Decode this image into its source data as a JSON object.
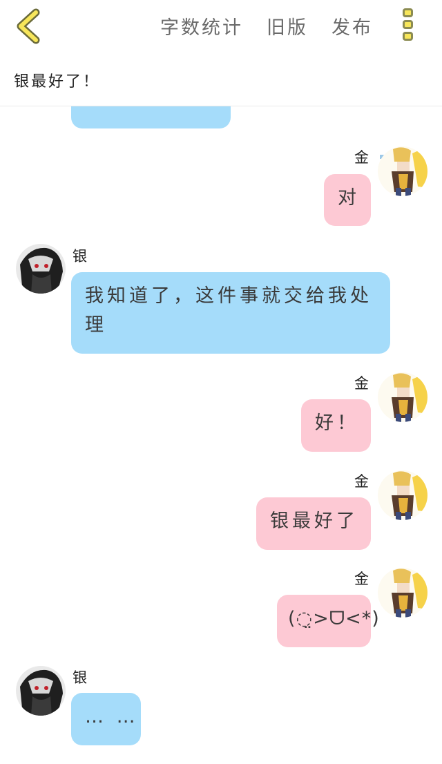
{
  "header": {
    "back_icon": "chevron-left-icon",
    "actions": [
      "字数统计",
      "旧版",
      "发布"
    ],
    "menu_icon": "more-vertical-icon",
    "accent": "#f7e65a"
  },
  "subtitle": "银最好了！",
  "characters": {
    "gin": {
      "name": "银",
      "bubble_color": "#a5dcfa"
    },
    "kin": {
      "name": "金",
      "bubble_color": "#fdc9d4"
    }
  },
  "messages": [
    {
      "from": "gin",
      "text": "…",
      "partial": true
    },
    {
      "from": "kin",
      "name": "金",
      "text": "对"
    },
    {
      "from": "gin",
      "name": "银",
      "text": "我知道了，这件事就交给我处",
      "text2": "理"
    },
    {
      "from": "kin",
      "name": "金",
      "text": "好！"
    },
    {
      "from": "kin",
      "name": "金",
      "text": "银最好了"
    },
    {
      "from": "kin",
      "name": "金",
      "text": "(◌̤>ᗜ<*)"
    },
    {
      "from": "gin",
      "name": "银",
      "text": "… …"
    }
  ]
}
